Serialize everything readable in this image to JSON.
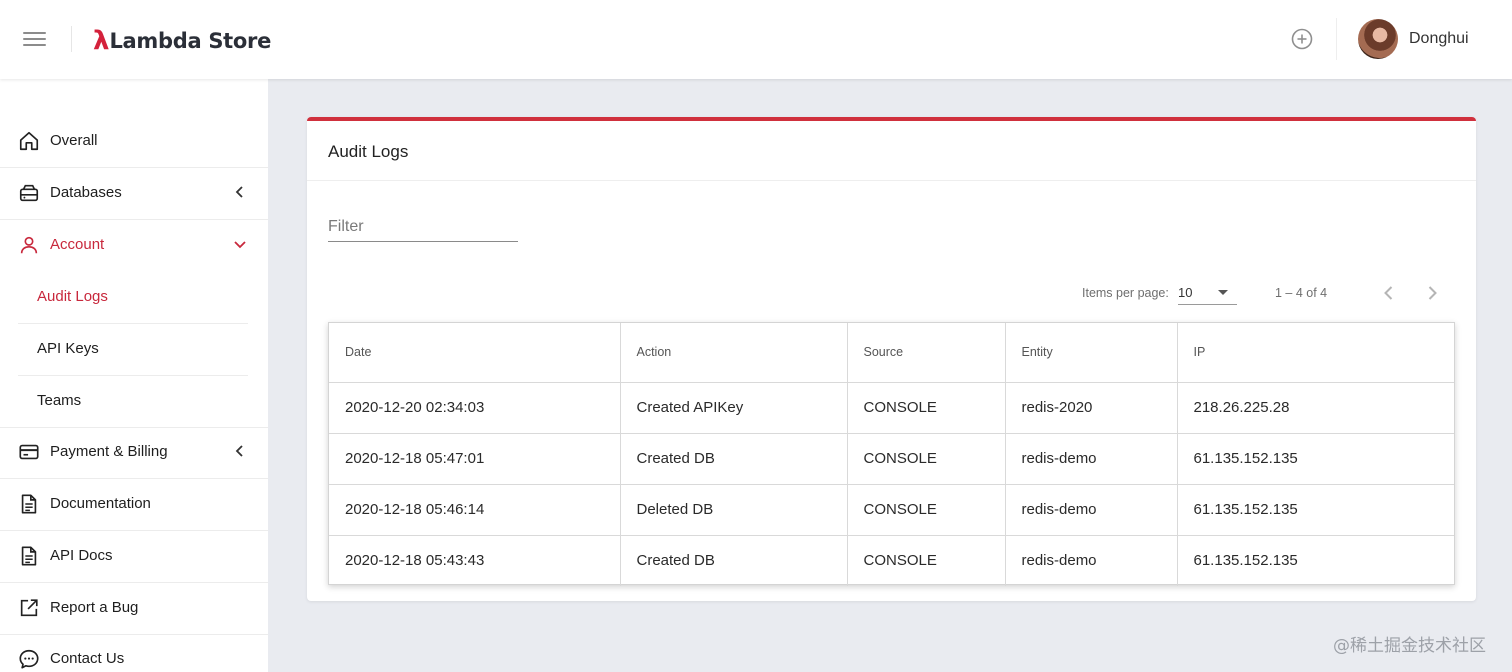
{
  "brand": {
    "mark": "λ",
    "name": "Lambda Store"
  },
  "header": {
    "user_name": "Donghui"
  },
  "sidebar": {
    "items": [
      {
        "label": "Overall",
        "icon": "home-icon"
      },
      {
        "label": "Databases",
        "icon": "database-icon"
      },
      {
        "label": "Account",
        "icon": "person-icon"
      },
      {
        "label": "Payment & Billing",
        "icon": "credit-card-icon"
      },
      {
        "label": "Documentation",
        "icon": "document-icon"
      },
      {
        "label": "API Docs",
        "icon": "document-icon"
      },
      {
        "label": "Report a Bug",
        "icon": "external-link-icon"
      },
      {
        "label": "Contact Us",
        "icon": "chat-bubble-icon"
      }
    ],
    "account_sub": [
      {
        "label": "Audit Logs"
      },
      {
        "label": "API Keys"
      },
      {
        "label": "Teams"
      }
    ]
  },
  "colors": {
    "accent": "#d0303d",
    "active_text": "#c8283c",
    "brand_mark": "#d4213b"
  },
  "card": {
    "title": "Audit Logs",
    "filter_placeholder": "Filter",
    "paginator": {
      "items_per_page_label": "Items per page:",
      "page_size": "10",
      "range": "1 – 4 of 4"
    }
  },
  "table": {
    "columns": [
      "Date",
      "Action",
      "Source",
      "Entity",
      "IP"
    ],
    "rows": [
      [
        "2020-12-20 02:34:03",
        "Created APIKey",
        "CONSOLE",
        "redis-2020",
        "218.26.225.28"
      ],
      [
        "2020-12-18 05:47:01",
        "Created DB",
        "CONSOLE",
        "redis-demo",
        "61.135.152.135"
      ],
      [
        "2020-12-18 05:46:14",
        "Deleted DB",
        "CONSOLE",
        "redis-demo",
        "61.135.152.135"
      ],
      [
        "2020-12-18 05:43:43",
        "Created DB",
        "CONSOLE",
        "redis-demo",
        "61.135.152.135"
      ]
    ]
  },
  "watermark": "@稀土掘金技术社区"
}
